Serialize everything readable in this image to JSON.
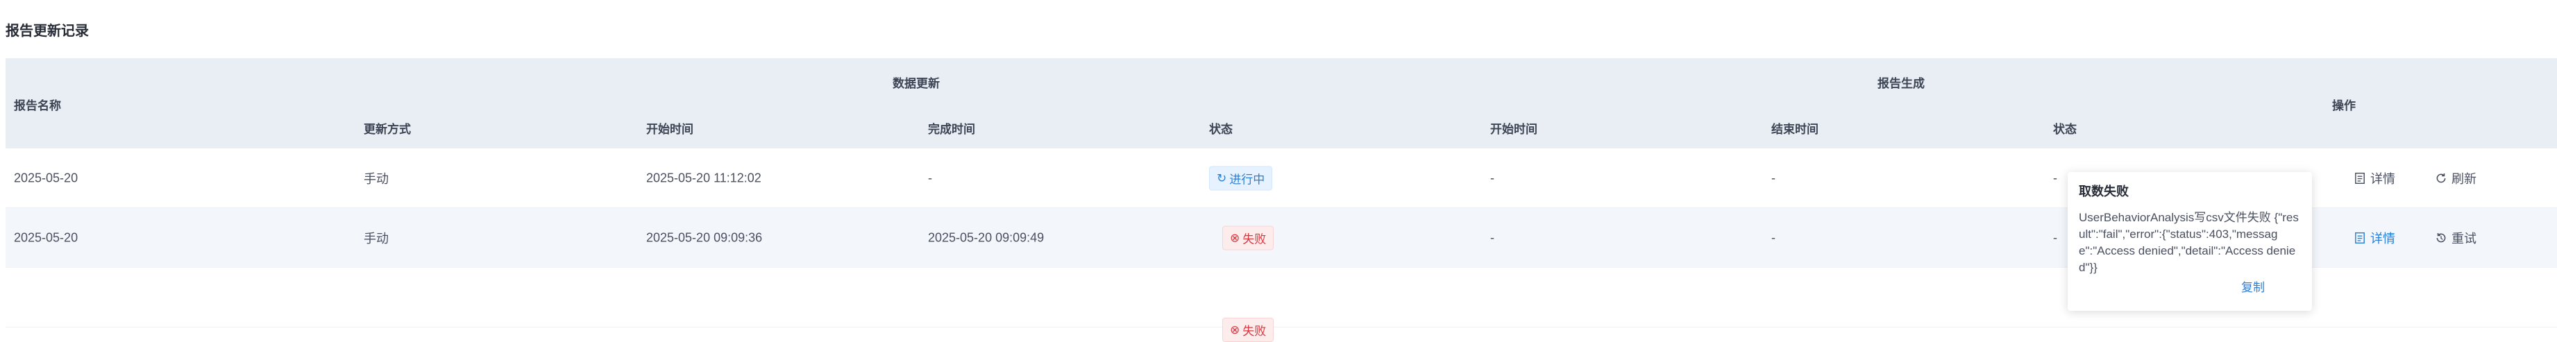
{
  "page": {
    "title": "报告更新记录"
  },
  "table": {
    "headers": {
      "report_name": "报告名称",
      "data_update": "数据更新",
      "report_gen": "报告生成",
      "actions": "操作",
      "update_method": "更新方式",
      "start_time": "开始时间",
      "finish_time": "完成时间",
      "status": "状态",
      "gen_start_time": "开始时间",
      "gen_end_time": "结束时间",
      "gen_status": "状态"
    },
    "rows": [
      {
        "name": "2025-05-20",
        "method": "手动",
        "start": "2025-05-20 11:12:02",
        "finish": "-",
        "status": "进行中",
        "gen_start": "-",
        "gen_end": "-",
        "gen_status": "-",
        "action1": "详情",
        "action2": "刷新"
      },
      {
        "name": "2025-05-20",
        "method": "手动",
        "start": "2025-05-20 09:09:36",
        "finish": "2025-05-20 09:09:49",
        "status": "失败",
        "gen_start": "-",
        "gen_end": "-",
        "gen_status": "-",
        "action1": "详情",
        "action2": "重试"
      },
      {
        "name": "",
        "method": "",
        "start": "",
        "finish": "",
        "status": "失败",
        "gen_start": "",
        "gen_end": "",
        "gen_status": "",
        "action1": "",
        "action2": ""
      }
    ]
  },
  "popover": {
    "title": "取数失败",
    "body": "UserBehaviorAnalysis写csv文件失败 {\"result\":\"fail\",\"error\":{\"status\":403,\"message\":\"Access denied\",\"detail\":\"Access denied\"}}",
    "copy_label": "复制"
  },
  "colors": {
    "header_bg": "#e9eef5",
    "alt_row_bg": "#f3f7fc",
    "accent": "#2b7fd6",
    "danger": "#d9363e"
  }
}
